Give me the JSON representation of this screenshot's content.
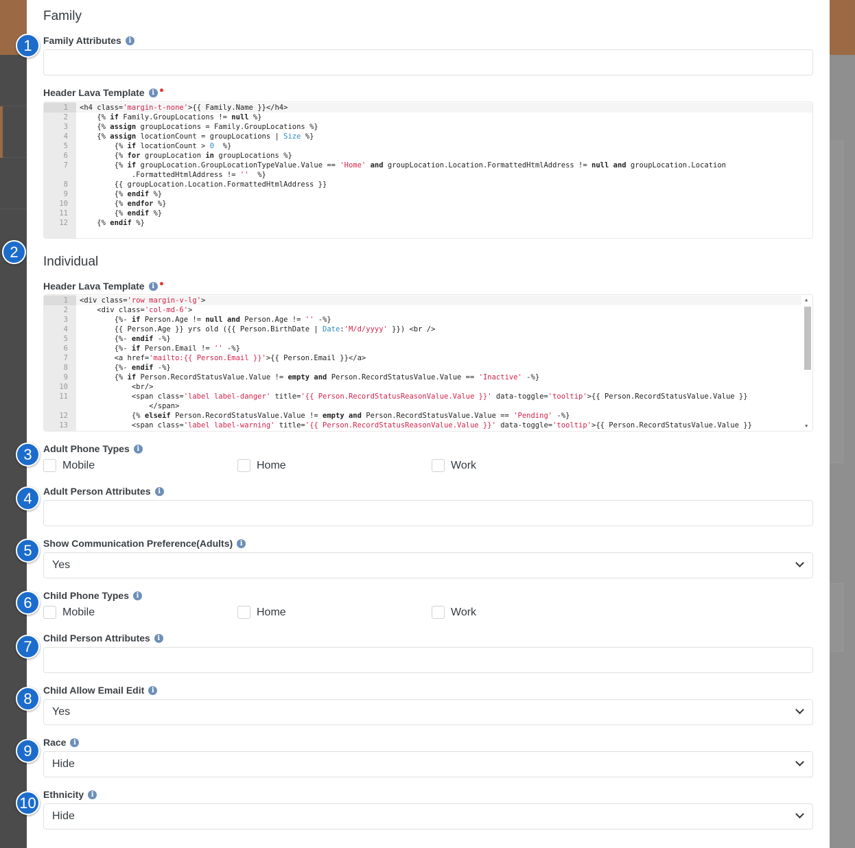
{
  "colors": {
    "accent": "#1c6ccc",
    "required": "#e03a3a",
    "string": "#d3234a",
    "filter": "#2d8ac7"
  },
  "family": {
    "heading": "Family",
    "attributes_label": "Family Attributes",
    "attributes_value": "",
    "header_template_label": "Header Lava Template",
    "code": [
      {
        "n": "1",
        "t": "<h4 class='margin-t-none'>{{ Family.Name }}</h4>"
      },
      {
        "n": "2",
        "t": "    {% if Family.GroupLocations != null %}"
      },
      {
        "n": "3",
        "t": "    {% assign groupLocations = Family.GroupLocations %}"
      },
      {
        "n": "4",
        "t": "    {% assign locationCount = groupLocations | Size %}"
      },
      {
        "n": "5",
        "t": "        {% if locationCount > 0  %}"
      },
      {
        "n": "6",
        "t": "        {% for groupLocation in groupLocations %}"
      },
      {
        "n": "7",
        "t": "        {% if groupLocation.GroupLocationTypeValue.Value == 'Home' and groupLocation.Location.FormattedHtmlAddress != null and groupLocation.Location"
      },
      {
        "n": "",
        "t": "            .FormattedHtmlAddress != ''  %}"
      },
      {
        "n": "8",
        "t": "        {{ groupLocation.Location.FormattedHtmlAddress }}"
      },
      {
        "n": "9",
        "t": "        {% endif %}"
      },
      {
        "n": "10",
        "t": "        {% endfor %}"
      },
      {
        "n": "11",
        "t": "        {% endif %}"
      },
      {
        "n": "12",
        "t": "    {% endif %}"
      }
    ]
  },
  "individual": {
    "heading": "Individual",
    "header_template_label": "Header Lava Template",
    "code": [
      {
        "n": "1",
        "t": "<div class='row margin-v-lg'>"
      },
      {
        "n": "2",
        "t": "    <div class='col-md-6'>"
      },
      {
        "n": "3",
        "t": "        {%- if Person.Age != null and Person.Age != '' -%}"
      },
      {
        "n": "4",
        "t": "        {{ Person.Age }} yrs old ({{ Person.BirthDate | Date:'M/d/yyyy' }}) <br />"
      },
      {
        "n": "5",
        "t": "        {%- endif -%}"
      },
      {
        "n": "6",
        "t": "        {%- if Person.Email != '' -%}"
      },
      {
        "n": "7",
        "t": "        <a href='mailto:{{ Person.Email }}'>{{ Person.Email }}</a>"
      },
      {
        "n": "8",
        "t": "        {%- endif -%}"
      },
      {
        "n": "9",
        "t": "        {% if Person.RecordStatusValue.Value != empty and Person.RecordStatusValue.Value == 'Inactive' -%}"
      },
      {
        "n": "10",
        "t": "            <br/>"
      },
      {
        "n": "11",
        "t": "            <span class='label label-danger' title='{{ Person.RecordStatusReasonValue.Value }}' data-toggle='tooltip'>{{ Person.RecordStatusValue.Value }}"
      },
      {
        "n": "",
        "t": "                </span>"
      },
      {
        "n": "12",
        "t": "            {% elseif Person.RecordStatusValue.Value != empty and Person.RecordStatusValue.Value == 'Pending' -%}"
      },
      {
        "n": "13",
        "t": "            <span class='label label-warning' title='{{ Person.RecordStatusReasonValue.Value }}' data-toggle='tooltip'>{{ Person.RecordStatusValue.Value }}"
      }
    ],
    "scroll_position_percent": 0
  },
  "adult_phone": {
    "label": "Adult Phone Types",
    "options": [
      {
        "label": "Mobile",
        "checked": false
      },
      {
        "label": "Home",
        "checked": false
      },
      {
        "label": "Work",
        "checked": false
      }
    ]
  },
  "adult_attributes": {
    "label": "Adult Person Attributes",
    "value": ""
  },
  "show_comm": {
    "label": "Show Communication Preference(Adults)",
    "value": "Yes"
  },
  "child_phone": {
    "label": "Child Phone Types",
    "options": [
      {
        "label": "Mobile",
        "checked": false
      },
      {
        "label": "Home",
        "checked": false
      },
      {
        "label": "Work",
        "checked": false
      }
    ]
  },
  "child_attributes": {
    "label": "Child Person Attributes",
    "value": ""
  },
  "child_email": {
    "label": "Child Allow Email Edit",
    "value": "Yes"
  },
  "race": {
    "label": "Race",
    "value": "Hide"
  },
  "ethnicity": {
    "label": "Ethnicity",
    "value": "Hide"
  },
  "badges": [
    "1",
    "2",
    "3",
    "4",
    "5",
    "6",
    "7",
    "8",
    "9",
    "10"
  ],
  "info_icon": "i"
}
